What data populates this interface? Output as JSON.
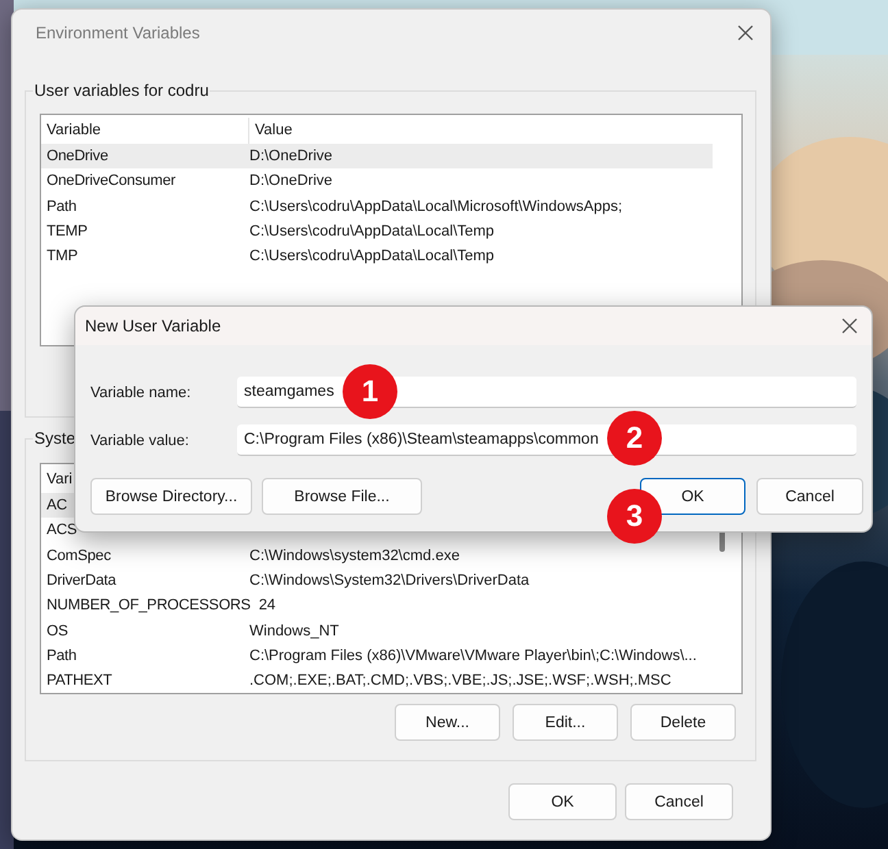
{
  "main_window": {
    "title": "Environment Variables",
    "user_group": {
      "label": "User variables for codru",
      "columns": [
        "Variable",
        "Value"
      ],
      "rows": [
        {
          "variable": "OneDrive",
          "value": "D:\\OneDrive",
          "selected": true
        },
        {
          "variable": "OneDriveConsumer",
          "value": "D:\\OneDrive",
          "selected": false
        },
        {
          "variable": "Path",
          "value": "C:\\Users\\codru\\AppData\\Local\\Microsoft\\WindowsApps;",
          "selected": false
        },
        {
          "variable": "TEMP",
          "value": "C:\\Users\\codru\\AppData\\Local\\Temp",
          "selected": false
        },
        {
          "variable": "TMP",
          "value": "C:\\Users\\codru\\AppData\\Local\\Temp",
          "selected": false
        }
      ]
    },
    "system_group": {
      "label": "Syste",
      "columns": [
        "Vari"
      ],
      "rows": [
        {
          "variable": "AC",
          "selected": true
        },
        {
          "variable": "ACS",
          "selected": false
        },
        {
          "variable": "ComSpec",
          "value": "C:\\Windows\\system32\\cmd.exe",
          "selected": false
        },
        {
          "variable": "DriverData",
          "value": "C:\\Windows\\System32\\Drivers\\DriverData",
          "selected": false
        },
        {
          "variable": "NUMBER_OF_PROCESSORS",
          "value": "24",
          "selected": false
        },
        {
          "variable": "OS",
          "value": "Windows_NT",
          "selected": false
        },
        {
          "variable": "Path",
          "value": "C:\\Program Files (x86)\\VMware\\VMware Player\\bin\\;C:\\Windows\\...",
          "selected": false
        },
        {
          "variable": "PATHEXT",
          "value": ".COM;.EXE;.BAT;.CMD;.VBS;.VBE;.JS;.JSE;.WSF;.WSH;.MSC",
          "selected": false
        }
      ],
      "buttons": [
        "New...",
        "Edit...",
        "Delete"
      ]
    },
    "buttons": [
      "OK",
      "Cancel"
    ]
  },
  "dialog": {
    "title": "New User Variable",
    "fields": [
      {
        "label": "Variable name:",
        "value": "steamgames"
      },
      {
        "label": "Variable value:",
        "value": "C:\\Program Files (x86)\\Steam\\steamapps\\common"
      }
    ],
    "buttons": [
      {
        "label": "Browse Directory...",
        "default": false
      },
      {
        "label": "Browse File...",
        "default": false
      },
      {
        "label": "OK",
        "default": true
      },
      {
        "label": "Cancel",
        "default": false
      }
    ]
  },
  "badges": [
    "1",
    "2",
    "3"
  ]
}
